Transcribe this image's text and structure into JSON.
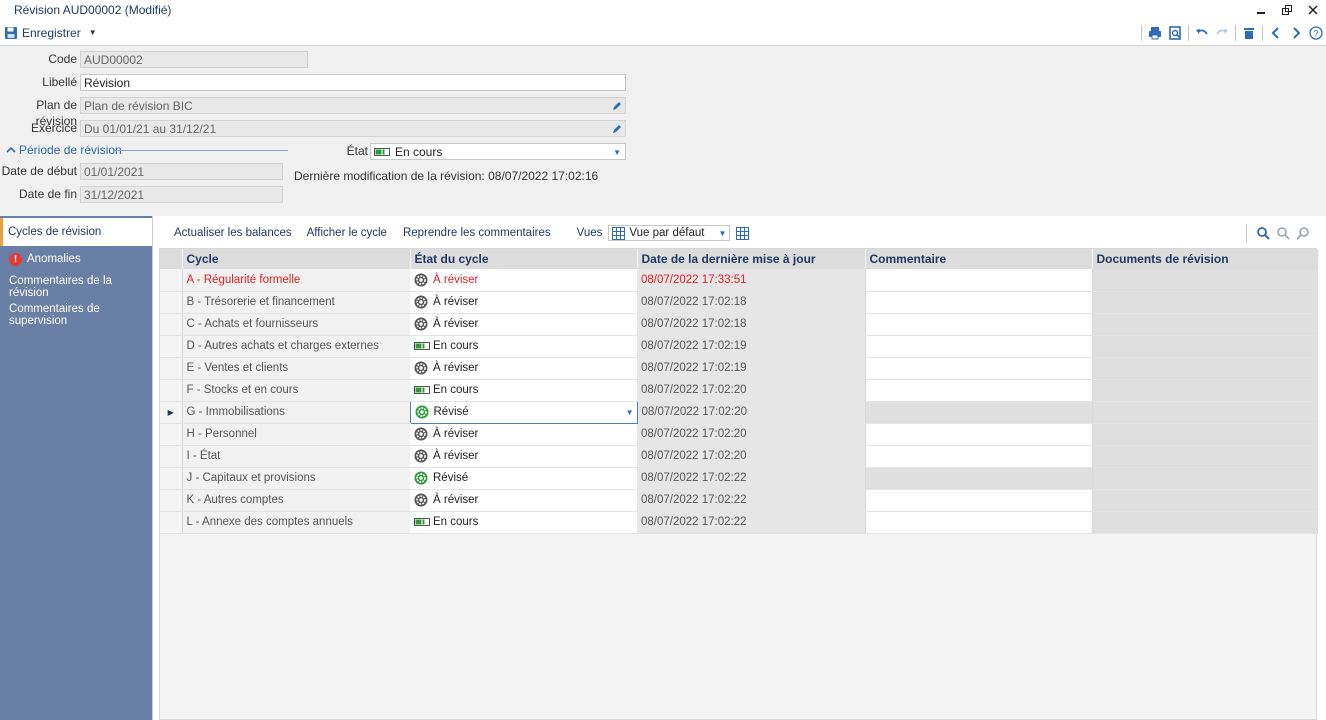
{
  "window": {
    "title": "Révision AUD00002 (Modifié)"
  },
  "toolbar": {
    "save_label": "Enregistrer"
  },
  "form": {
    "code_label": "Code",
    "code_value": "AUD00002",
    "libelle_label": "Libellé",
    "libelle_value": "Révision",
    "plan_label": "Plan de révision",
    "plan_value": "Plan de révision BIC",
    "exercice_label": "Exercice",
    "exercice_value": "Du 01/01/21 au 31/12/21",
    "periode_title": "Période de révision",
    "date_debut_label": "Date de début",
    "date_debut_value": "01/01/2021",
    "date_fin_label": "Date de fin",
    "date_fin_value": "31/12/2021",
    "etat_label": "État",
    "etat_value": "En cours",
    "last_modif": "Dernière modification de la révision: 08/07/2022 17:02:16"
  },
  "sidebar": {
    "items": [
      {
        "label": "Cycles de révision"
      },
      {
        "label": "Anomalies"
      },
      {
        "label": "Commentaires de la révision"
      },
      {
        "label": "Commentaires de supervision"
      }
    ]
  },
  "grid_toolbar": {
    "actualiser": "Actualiser les balances",
    "afficher": "Afficher le cycle",
    "reprendre": "Reprendre les commentaires",
    "vues_label": "Vues",
    "vue_selected": "Vue par défaut"
  },
  "grid": {
    "columns": [
      "Cycle",
      "État du cycle",
      "Date de la dernière mise à jour",
      "Commentaire",
      "Documents de révision"
    ],
    "rows": [
      {
        "cycle": "A - Régularité formelle",
        "etat": "À réviser",
        "icon": "gear-icon",
        "date": "08/07/2022 17:33:51"
      },
      {
        "cycle": "B - Trésorerie et financement",
        "etat": "À réviser",
        "icon": "gear-icon",
        "date": "08/07/2022 17:02:18"
      },
      {
        "cycle": "C - Achats et fournisseurs",
        "etat": "À réviser",
        "icon": "gear-icon",
        "date": "08/07/2022 17:02:18"
      },
      {
        "cycle": "D - Autres achats et charges externes",
        "etat": "En cours",
        "icon": "progress-icon",
        "date": "08/07/2022 17:02:19"
      },
      {
        "cycle": "E - Ventes et clients",
        "etat": "À réviser",
        "icon": "gear-icon",
        "date": "08/07/2022 17:02:19"
      },
      {
        "cycle": "F - Stocks et en cours",
        "etat": "En cours",
        "icon": "progress-icon",
        "date": "08/07/2022 17:02:20"
      },
      {
        "cycle": "G - Immobilisations",
        "etat": "Révisé",
        "icon": "check-gear-icon",
        "date": "08/07/2022 17:02:20"
      },
      {
        "cycle": "H - Personnel",
        "etat": "À réviser",
        "icon": "gear-icon",
        "date": "08/07/2022 17:02:20"
      },
      {
        "cycle": "I - État",
        "etat": "À réviser",
        "icon": "gear-icon",
        "date": "08/07/2022 17:02:20"
      },
      {
        "cycle": "J - Capitaux et provisions",
        "etat": "Révisé",
        "icon": "check-gear-icon",
        "date": "08/07/2022 17:02:22"
      },
      {
        "cycle": "K - Autres comptes",
        "etat": "À réviser",
        "icon": "gear-icon",
        "date": "08/07/2022 17:02:22"
      },
      {
        "cycle": "L - Annexe des comptes annuels",
        "etat": "En cours",
        "icon": "progress-icon",
        "date": "08/07/2022 17:02:22"
      }
    ]
  },
  "colors": {
    "accent": "#2c6bb5",
    "sidebar": "#6a7fa6",
    "alert": "#e02020"
  }
}
